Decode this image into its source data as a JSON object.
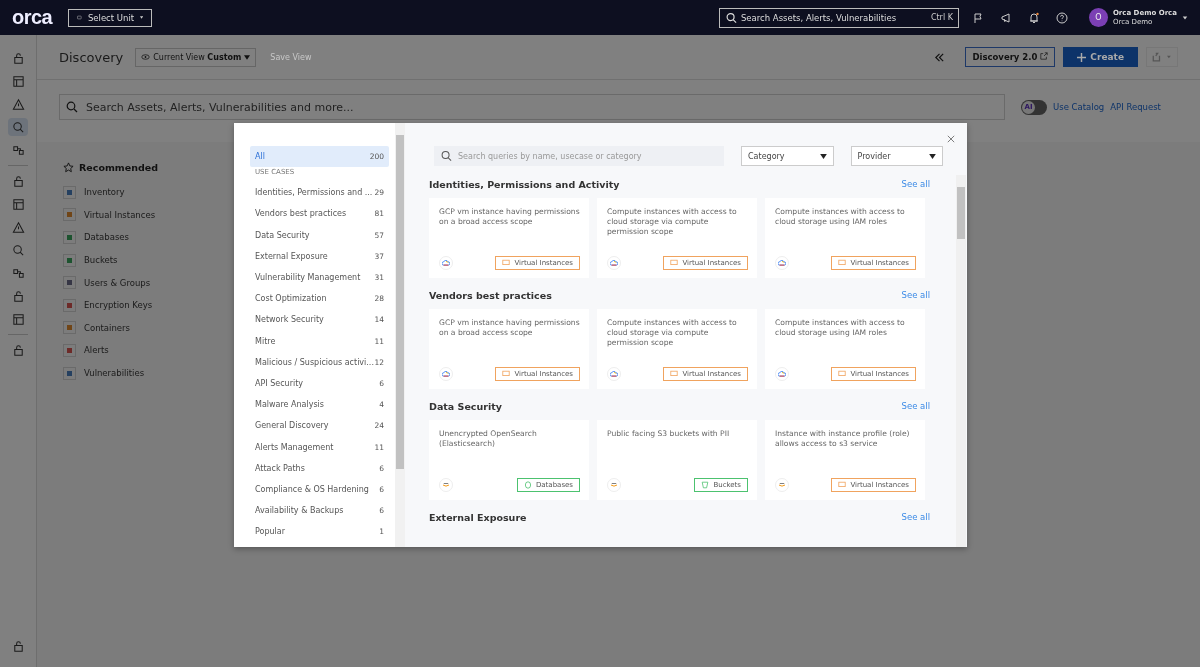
{
  "topbar": {
    "logo": "orca",
    "unit_select": "Select Unit",
    "search": {
      "placeholder": "Search Assets, Alerts, Vulnerabilities",
      "shortcut": "Ctrl K"
    },
    "user": {
      "initial": "O",
      "name": "Orca Demo Orca",
      "org": "Orca Demo"
    }
  },
  "rail_groups": [
    [
      {
        "selected": false
      },
      {
        "selected": false
      },
      {
        "selected": false
      },
      {
        "selected": true
      },
      {
        "selected": false
      }
    ],
    [
      {
        "selected": false
      },
      {
        "selected": false
      },
      {
        "selected": false
      },
      {
        "selected": false
      },
      {
        "selected": false
      },
      {
        "selected": false
      },
      {
        "selected": false
      }
    ],
    [
      {
        "selected": false
      }
    ],
    [
      {
        "selected": false
      }
    ]
  ],
  "header": {
    "title": "Discovery",
    "view_select": "Current View **Custom**",
    "save_view": {
      "label": "Save View",
      "disabled": true
    },
    "discovery2": "Discovery 2.0",
    "create": "Create"
  },
  "main_search": {
    "placeholder": "Search Assets, Alerts, Vulnerabilities and more...",
    "ai_toggle": {
      "label": "AI",
      "on": false
    },
    "links": [
      "Use Catalog",
      "API Request"
    ]
  },
  "recommended": {
    "title": "Recommended",
    "items": [
      {
        "label": "Inventory",
        "color": "#254060"
      },
      {
        "label": "Virtual Instances",
        "color": "#704517"
      },
      {
        "label": "Databases",
        "color": "#1d532f"
      },
      {
        "label": "Buckets",
        "color": "#1d532f"
      },
      {
        "label": "Users & Groups",
        "color": "#363645"
      },
      {
        "label": "Encryption Keys",
        "color": "#6d2a28"
      },
      {
        "label": "Containers",
        "color": "#704517"
      },
      {
        "label": "Alerts",
        "color": "#6d2a28"
      },
      {
        "label": "Vulnerabilities",
        "color": "#254060"
      }
    ]
  },
  "modal": {
    "categories": [
      {
        "label": "All",
        "count": "200",
        "selected": true
      }
    ],
    "use_cases_heading": "USE CASES",
    "use_cases": [
      {
        "label": "Identities, Permissions and ...",
        "count": "29",
        "selected": false
      },
      {
        "label": "Vendors best practices",
        "count": "81",
        "selected": false
      },
      {
        "label": "Data Security",
        "count": "57",
        "selected": false
      },
      {
        "label": "External Exposure",
        "count": "37",
        "selected": false
      },
      {
        "label": "Vulnerability Management",
        "count": "31",
        "selected": false
      },
      {
        "label": "Cost Optimization",
        "count": "28",
        "selected": false
      },
      {
        "label": "Network Security",
        "count": "14",
        "selected": false
      },
      {
        "label": "Mitre",
        "count": "11",
        "selected": false
      },
      {
        "label": "Malicious / Suspicious activi...",
        "count": "12",
        "selected": false
      },
      {
        "label": "API Security",
        "count": "6",
        "selected": false
      },
      {
        "label": "Malware Analysis",
        "count": "4",
        "selected": false
      },
      {
        "label": "General Discovery",
        "count": "24",
        "selected": false
      },
      {
        "label": "Alerts Management",
        "count": "11",
        "selected": false
      },
      {
        "label": "Attack Paths",
        "count": "6",
        "selected": false
      },
      {
        "label": "Compliance & OS Hardening",
        "count": "6",
        "selected": false
      },
      {
        "label": "Availability & Backups",
        "count": "6",
        "selected": false
      },
      {
        "label": "Popular",
        "count": "1",
        "selected": false
      }
    ],
    "search": {
      "placeholder": "Search queries by name, usecase or category"
    },
    "filters": [
      "Category",
      "Provider"
    ],
    "sections": [
      {
        "title": "Identities, Permissions and Activity",
        "see_all": "See all",
        "cards": [
          {
            "title": "GCP vm instance having permissions on a broad access scope",
            "provider": {
              "kind": "gcp"
            },
            "tag": {
              "label": "Virtual Instances",
              "kind": "instances"
            }
          },
          {
            "title": "Compute instances with access to cloud storage via compute permission scope",
            "provider": {
              "kind": "gcp"
            },
            "tag": {
              "label": "Virtual Instances",
              "kind": "instances"
            }
          },
          {
            "title": "Compute instances with access to cloud storage using IAM roles",
            "provider": {
              "kind": "gcp"
            },
            "tag": {
              "label": "Virtual Instances",
              "kind": "instances"
            }
          }
        ]
      },
      {
        "title": "Vendors best practices",
        "see_all": "See all",
        "cards": [
          {
            "title": "GCP vm instance having permissions on a broad access scope",
            "provider": {
              "kind": "gcp"
            },
            "tag": {
              "label": "Virtual Instances",
              "kind": "instances"
            }
          },
          {
            "title": "Compute instances with access to cloud storage via compute permission scope",
            "provider": {
              "kind": "gcp"
            },
            "tag": {
              "label": "Virtual Instances",
              "kind": "instances"
            }
          },
          {
            "title": "Compute instances with access to cloud storage using IAM roles",
            "provider": {
              "kind": "gcp"
            },
            "tag": {
              "label": "Virtual Instances",
              "kind": "instances"
            }
          }
        ]
      },
      {
        "title": "Data Security",
        "see_all": "See all",
        "cards": [
          {
            "title": "Unencrypted OpenSearch (Elasticsearch)",
            "provider": {
              "kind": "aws"
            },
            "tag": {
              "label": "Databases",
              "kind": "databases"
            }
          },
          {
            "title": "Public facing S3 buckets with PII",
            "provider": {
              "kind": "aws"
            },
            "tag": {
              "label": "Buckets",
              "kind": "buckets"
            }
          },
          {
            "title": "Instance with instance profile (role) allows access to s3 service",
            "provider": {
              "kind": "aws"
            },
            "tag": {
              "label": "Virtual Instances",
              "kind": "instances"
            }
          }
        ]
      },
      {
        "title": "External Exposure",
        "see_all": "See all"
      }
    ]
  }
}
